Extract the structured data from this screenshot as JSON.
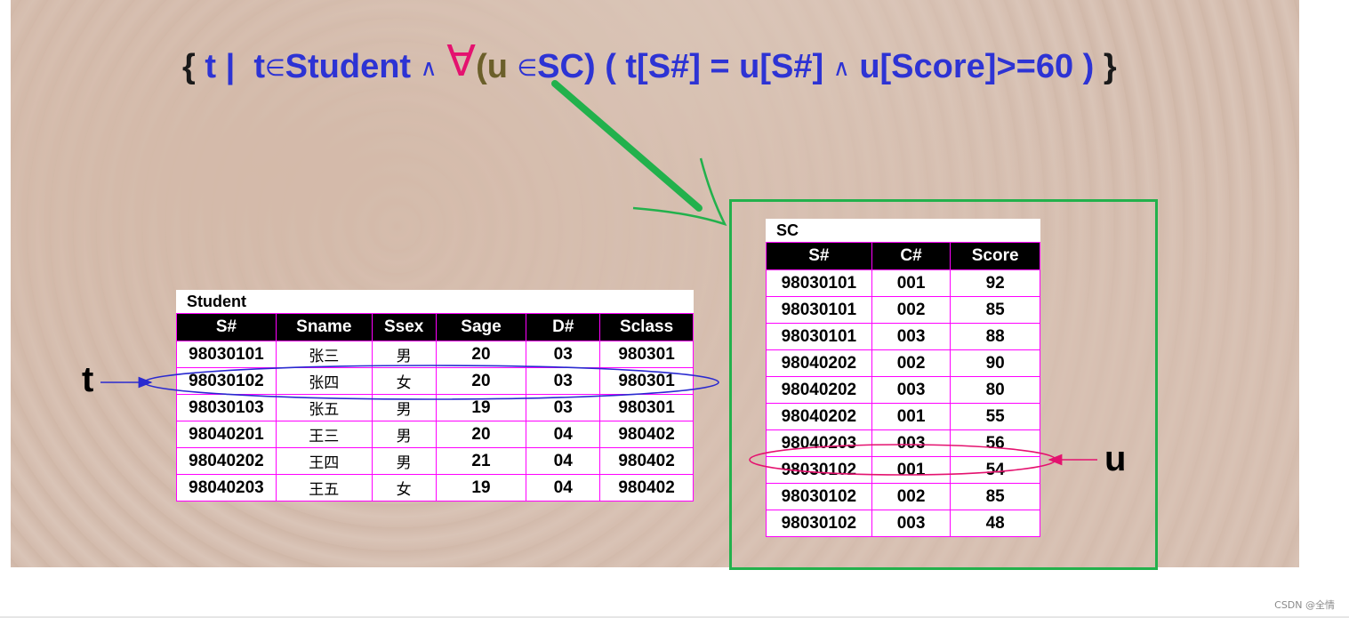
{
  "formula": {
    "open_brace": "{",
    "t1": "t |",
    "t2": "t",
    "in1": "∈",
    "student": "Student",
    "and1": "∧",
    "forall": "∀",
    "u_open": "(u",
    "in2": "∈",
    "sc": "SC)",
    "cond": "( t[S#] = u[S#]",
    "and2": "∧",
    "cond2": "u[Score]>=60 )",
    "close_brace": "}"
  },
  "student": {
    "caption": "Student",
    "headers": [
      "S#",
      "Sname",
      "Ssex",
      "Sage",
      "D#",
      "Sclass"
    ],
    "rows": [
      [
        "98030101",
        "张三",
        "男",
        "20",
        "03",
        "980301"
      ],
      [
        "98030102",
        "张四",
        "女",
        "20",
        "03",
        "980301"
      ],
      [
        "98030103",
        "张五",
        "男",
        "19",
        "03",
        "980301"
      ],
      [
        "98040201",
        "王三",
        "男",
        "20",
        "04",
        "980402"
      ],
      [
        "98040202",
        "王四",
        "男",
        "21",
        "04",
        "980402"
      ],
      [
        "98040203",
        "王五",
        "女",
        "19",
        "04",
        "980402"
      ]
    ]
  },
  "sc": {
    "caption": "SC",
    "headers": [
      "S#",
      "C#",
      "Score"
    ],
    "rows": [
      [
        "98030101",
        "001",
        "92"
      ],
      [
        "98030101",
        "002",
        "85"
      ],
      [
        "98030101",
        "003",
        "88"
      ],
      [
        "98040202",
        "002",
        "90"
      ],
      [
        "98040202",
        "003",
        "80"
      ],
      [
        "98040202",
        "001",
        "55"
      ],
      [
        "98040203",
        "003",
        "56"
      ],
      [
        "98030102",
        "001",
        "54"
      ],
      [
        "98030102",
        "002",
        "85"
      ],
      [
        "98030102",
        "003",
        "48"
      ]
    ]
  },
  "labels": {
    "t": "t",
    "u": "u"
  },
  "colors": {
    "formula_blue": "#2d33d4",
    "forall_pink": "#e4126f",
    "olive": "#6b5f2a",
    "green": "#22b14c",
    "table_border": "#ff00ff",
    "t_ellipse": "#2a2ad0",
    "u_ellipse": "#e4126f"
  },
  "footer": {
    "watermark": "CSDN @全情"
  }
}
